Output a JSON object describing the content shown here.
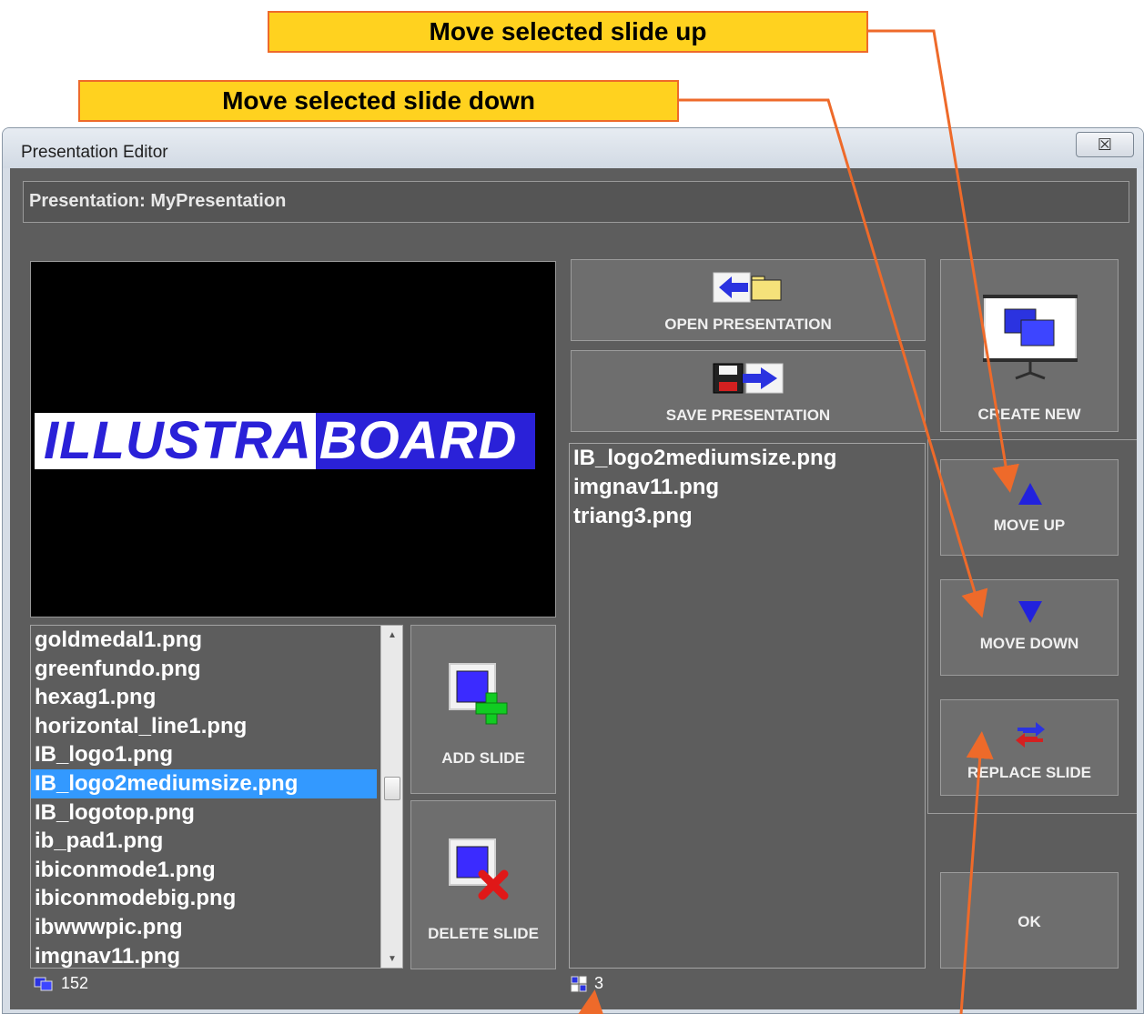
{
  "callouts": {
    "move_up": "Move selected slide up",
    "move_down": "Move selected slide down"
  },
  "window": {
    "title": "Presentation Editor",
    "close_glyph": "☒"
  },
  "header": {
    "presentation_label": "Presentation: MyPresentation"
  },
  "preview": {
    "logo_left": "ILLUSTRA",
    "logo_right": "BOARD"
  },
  "file_list": {
    "items": [
      "goldmedal1.png",
      "greenfundo.png",
      "hexag1.png",
      "horizontal_line1.png",
      "IB_logo1.png",
      "IB_logo2mediumsize.png",
      "IB_logotop.png",
      "ib_pad1.png",
      "ibiconmode1.png",
      "ibiconmodebig.png",
      "ibwwwpic.png",
      "imgnav11.png"
    ],
    "selected_index": 5
  },
  "buttons": {
    "add_slide": "ADD SLIDE",
    "delete_slide": "DELETE SLIDE",
    "open_presentation": "OPEN PRESENTATION",
    "save_presentation": "SAVE PRESENTATION",
    "create_new": "CREATE NEW",
    "move_up": "MOVE UP",
    "move_down": "MOVE DOWN",
    "replace_slide": "REPLACE SLIDE",
    "ok": "OK"
  },
  "slide_list": {
    "items": [
      "IB_logo2mediumsize.png",
      "imgnav11.png",
      "triang3.png"
    ]
  },
  "status": {
    "file_count": "152",
    "slide_count": "3"
  },
  "colors": {
    "callout_fill": "#ffd21f",
    "callout_border": "#ee6a2a",
    "selection": "#3399ff",
    "panel_bg": "#5d5d5d",
    "logo_blue": "#2a21d8",
    "arrow_blue": "#2222dd"
  }
}
